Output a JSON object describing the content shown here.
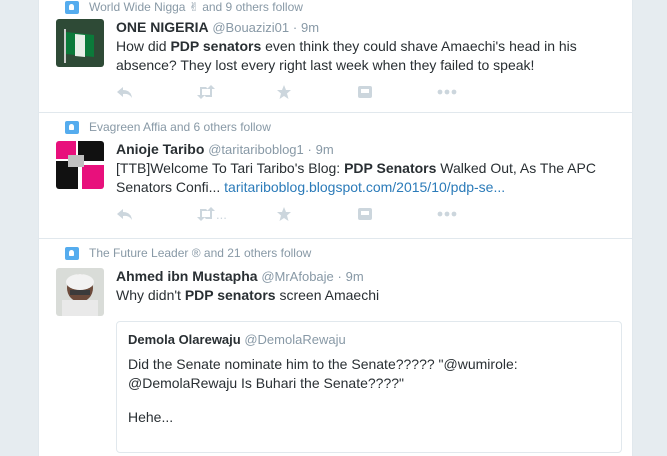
{
  "tweets": [
    {
      "context": "World Wide Nigga ✌ and 9 others follow",
      "name": "ONE NIGERIA",
      "handle": "@Bouazizi01",
      "dot": "·",
      "time": "9m",
      "text_parts": [
        "How did ",
        "PDP senators",
        " even think they could shave Amaechi's head in his absence? They lost every right last week when they failed to speak!"
      ],
      "avatar": "nigeria-flag"
    },
    {
      "context": "Evagreen Affia and 6 others follow",
      "name": "Anioje Taribo",
      "handle": "@taritariboblog1",
      "dot": "·",
      "time": "9m",
      "text_parts": [
        "[TTB]Welcome To Tari Taribo's Blog: ",
        "PDP Senators",
        " Walked Out, As The APC Senators Confi... "
      ],
      "link": "taritariboblog.blogspot.com/2015/10/pdp-se...",
      "retweet_more": "...",
      "avatar": "pink-black-collage"
    },
    {
      "context": "The Future Leader ® and 21 others follow",
      "name": "Ahmed ibn Mustapha",
      "handle": "@MrAfobaje",
      "dot": "·",
      "time": "9m",
      "text_parts": [
        "Why didn't ",
        "PDP senators",
        " screen Amaechi"
      ],
      "avatar": "person-photo",
      "quote": {
        "name": "Demola Olarewaju",
        "handle": "@DemolaRewaju",
        "text": "Did the Senate nominate him to the Senate????? \"@wumirole: @DemolaRewaju Is Buhari the Senate????\"",
        "text2": "Hehe..."
      }
    }
  ],
  "colors": {
    "accent": "#55acee",
    "muted": "#8899a6",
    "icon": "#ccd6dd",
    "border": "#e1e8ed",
    "link": "#2b7bb9"
  },
  "icons": [
    "reply-icon",
    "retweet-icon",
    "favorite-icon",
    "card-icon",
    "more-icon",
    "follow-context-icon"
  ]
}
